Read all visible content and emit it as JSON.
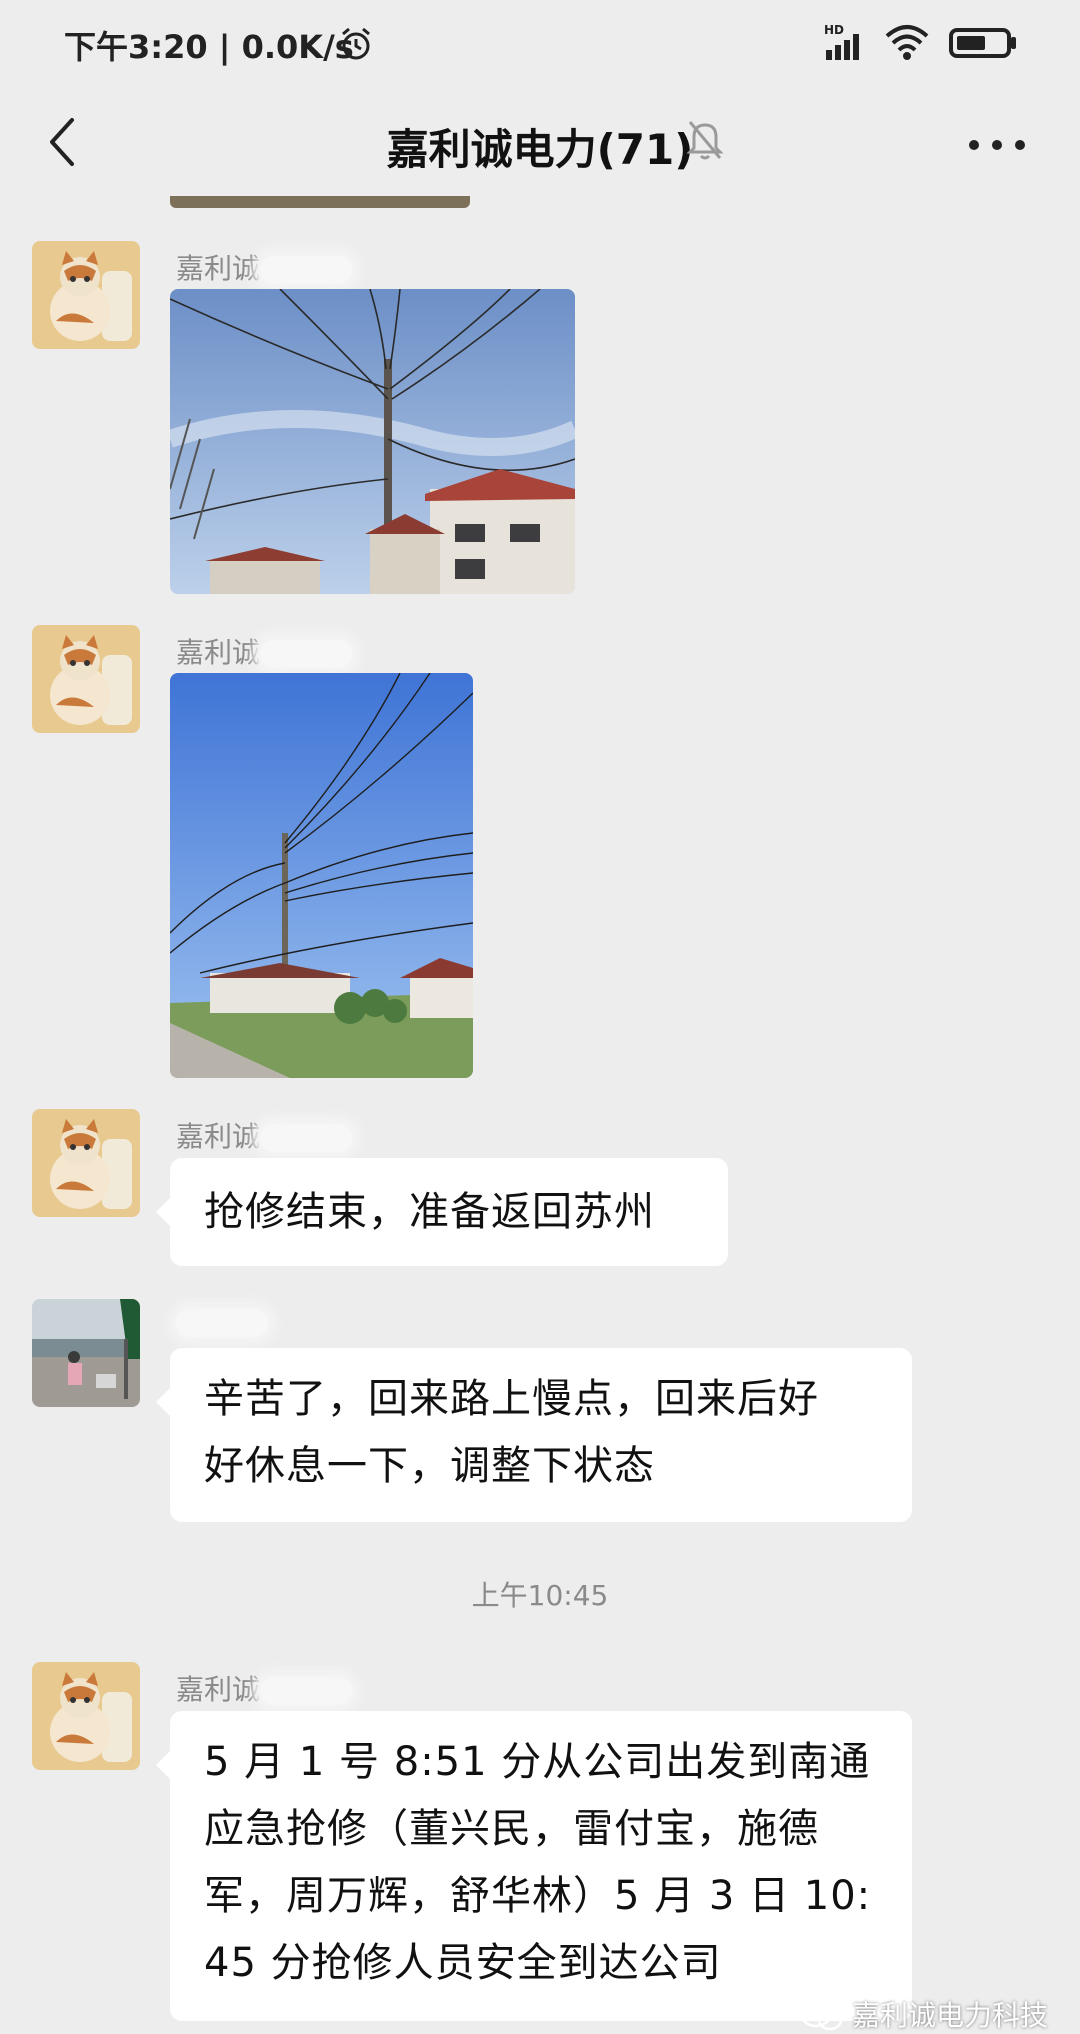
{
  "status_bar": {
    "time": "下午3:20",
    "speed": "0.0K/s",
    "signal_label": "HD"
  },
  "header": {
    "title": "嘉利诚电力(71)"
  },
  "messages": [
    {
      "type": "image",
      "sender": "嘉利诚",
      "description": "utility pole with power lines"
    },
    {
      "type": "image",
      "sender": "嘉利诚",
      "description": "power lines against blue sky"
    },
    {
      "type": "text",
      "sender": "嘉利诚",
      "text": "抢修结束，准备返回苏州"
    },
    {
      "type": "text",
      "sender": "",
      "lines": [
        "辛苦了，回来路上慢点，回来后好",
        "好休息一下，调整下状态"
      ]
    },
    {
      "type": "text",
      "sender": "嘉利诚",
      "lines": [
        "5 月 1 号 8:51 分从公司出发到南通",
        "应急抢修（董兴民，雷付宝，施德",
        "军，周万辉，舒华林）5 月 3 日 10:",
        "45 分抢修人员安全到达公司"
      ]
    }
  ],
  "timestamp": "上午10:45",
  "watermark": "嘉利诚电力科技",
  "colors": {
    "background": "#ededed",
    "bubble": "#ffffff",
    "meta_text": "#8a8a8a"
  }
}
